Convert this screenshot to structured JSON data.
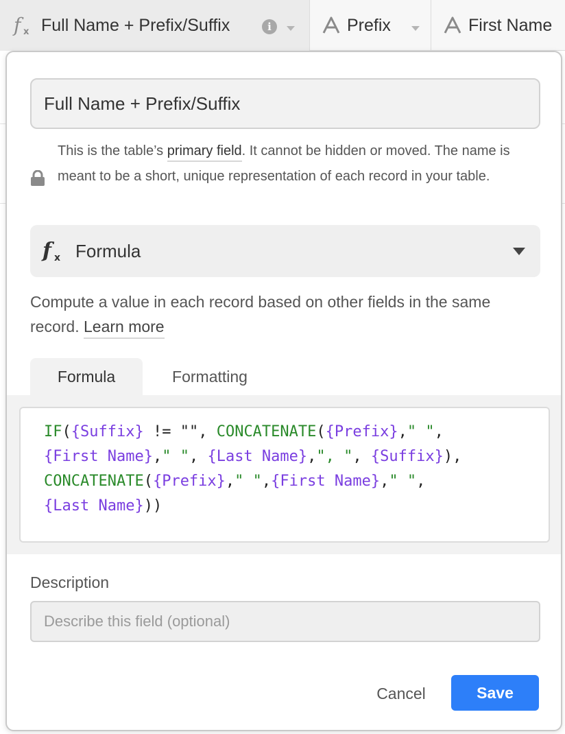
{
  "grid_header": {
    "columns": [
      {
        "label": "Full Name + Prefix/Suffix",
        "icon": "formula-icon"
      },
      {
        "label": "Prefix",
        "icon": "text-a-icon"
      },
      {
        "label": "First Name",
        "icon": "text-a-icon"
      }
    ]
  },
  "dialog": {
    "field_name": "Full Name + Prefix/Suffix",
    "primary_note": {
      "before": "This is the table’s ",
      "link": "primary field",
      "after": ". It cannot be hidden or moved. The name is meant to be a short, unique representation of each record in your table."
    },
    "field_type": {
      "label": "Formula",
      "icon": "formula-icon"
    },
    "type_description": {
      "text": "Compute a value in each record based on other fields in the same record. ",
      "link": "Learn more"
    },
    "tabs": [
      {
        "label": "Formula",
        "active": true
      },
      {
        "label": "Formatting",
        "active": false
      }
    ],
    "formula_lines": [
      [
        {
          "t": "IF",
          "c": "fn"
        },
        {
          "t": "(",
          "c": "op"
        },
        {
          "t": "{Suffix}",
          "c": "ref"
        },
        {
          "t": " != ",
          "c": "op"
        },
        {
          "t": "\"\"",
          "c": "op"
        },
        {
          "t": ", ",
          "c": "op"
        },
        {
          "t": "CONCATENATE",
          "c": "fn"
        },
        {
          "t": "(",
          "c": "op"
        },
        {
          "t": "{Prefix}",
          "c": "ref"
        },
        {
          "t": ",",
          "c": "op"
        },
        {
          "t": "\" \"",
          "c": "str"
        },
        {
          "t": ",",
          "c": "op"
        }
      ],
      [
        {
          "t": "{First Name}",
          "c": "ref"
        },
        {
          "t": ",",
          "c": "op"
        },
        {
          "t": "\" \"",
          "c": "str"
        },
        {
          "t": ", ",
          "c": "op"
        },
        {
          "t": "{Last Name}",
          "c": "ref"
        },
        {
          "t": ",",
          "c": "op"
        },
        {
          "t": "\", \"",
          "c": "str"
        },
        {
          "t": ", ",
          "c": "op"
        },
        {
          "t": "{Suffix}",
          "c": "ref"
        },
        {
          "t": "),",
          "c": "op"
        }
      ],
      [
        {
          "t": "CONCATENATE",
          "c": "fn"
        },
        {
          "t": "(",
          "c": "op"
        },
        {
          "t": "{Prefix}",
          "c": "ref"
        },
        {
          "t": ",",
          "c": "op"
        },
        {
          "t": "\" \"",
          "c": "str"
        },
        {
          "t": ",",
          "c": "op"
        },
        {
          "t": "{First Name}",
          "c": "ref"
        },
        {
          "t": ",",
          "c": "op"
        },
        {
          "t": "\" \"",
          "c": "str"
        },
        {
          "t": ",",
          "c": "op"
        }
      ],
      [
        {
          "t": "{Last Name}",
          "c": "ref"
        },
        {
          "t": "))",
          "c": "op"
        }
      ]
    ],
    "description": {
      "label": "Description",
      "value": "",
      "placeholder": "Describe this field (optional)"
    },
    "buttons": {
      "cancel": "Cancel",
      "save": "Save"
    }
  },
  "colors": {
    "accent": "#2d7ff9",
    "formula_function": "#2a8a2a",
    "formula_reference": "#7a3ee0"
  }
}
